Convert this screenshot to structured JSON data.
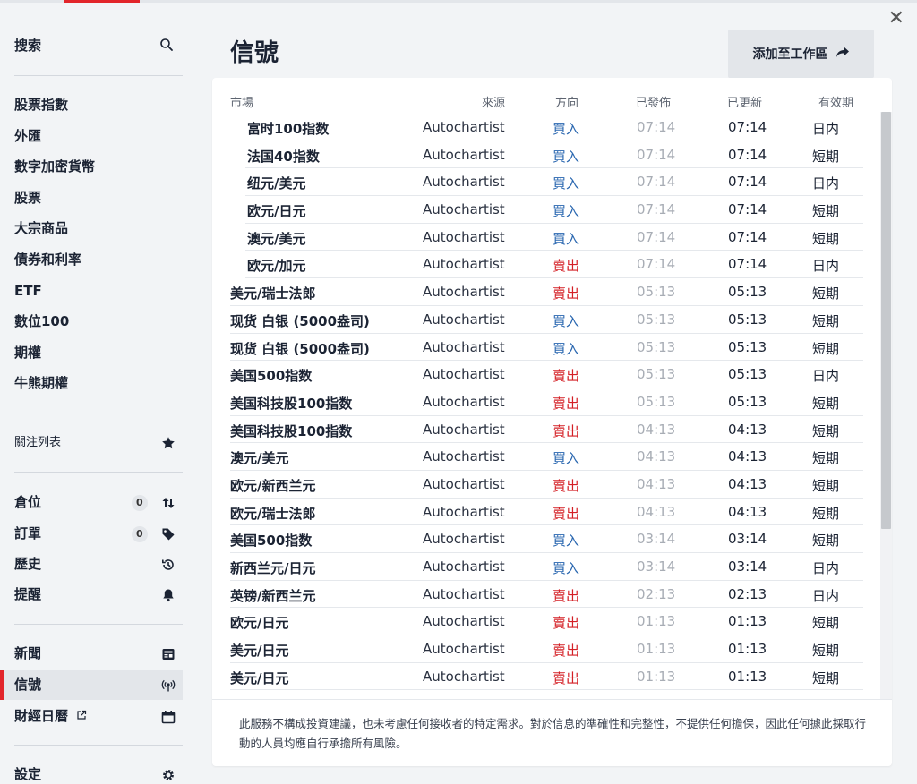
{
  "sidebar": {
    "search_label": "搜索",
    "markets": [
      "股票指數",
      "外匯",
      "數字加密貨幣",
      "股票",
      "大宗商品",
      "債券和利率",
      "ETF",
      "數位100",
      "期權",
      "牛熊期權"
    ],
    "watchlist_label": "關注列表",
    "positions_label": "倉位",
    "positions_count": "0",
    "orders_label": "訂單",
    "orders_count": "0",
    "history_label": "歷史",
    "alerts_label": "提醒",
    "news_label": "新聞",
    "signals_label": "信號",
    "calendar_label": "財經日曆",
    "settings_label": "設定"
  },
  "page": {
    "title": "信號",
    "add_button_label": "添加至工作區"
  },
  "table": {
    "headers": {
      "market": "市場",
      "source": "來源",
      "direction": "方向",
      "published": "已發佈",
      "updated": "已更新",
      "validity": "有效期"
    },
    "rows": [
      {
        "market": "富时100指数",
        "source": "Autochartist",
        "direction": "買入",
        "published": "07:14",
        "updated": "07:14",
        "validity": "日内",
        "indent": true
      },
      {
        "market": "法国40指数",
        "source": "Autochartist",
        "direction": "買入",
        "published": "07:14",
        "updated": "07:14",
        "validity": "短期",
        "indent": true
      },
      {
        "market": "纽元/美元",
        "source": "Autochartist",
        "direction": "買入",
        "published": "07:14",
        "updated": "07:14",
        "validity": "日内",
        "indent": true
      },
      {
        "market": "欧元/日元",
        "source": "Autochartist",
        "direction": "買入",
        "published": "07:14",
        "updated": "07:14",
        "validity": "短期",
        "indent": true
      },
      {
        "market": "澳元/美元",
        "source": "Autochartist",
        "direction": "買入",
        "published": "07:14",
        "updated": "07:14",
        "validity": "短期",
        "indent": true
      },
      {
        "market": "欧元/加元",
        "source": "Autochartist",
        "direction": "賣出",
        "published": "07:14",
        "updated": "07:14",
        "validity": "日内",
        "indent": true
      },
      {
        "market": "美元/瑞士法郎",
        "source": "Autochartist",
        "direction": "賣出",
        "published": "05:13",
        "updated": "05:13",
        "validity": "短期",
        "indent": false
      },
      {
        "market": "现货 白银 (5000盎司)",
        "source": "Autochartist",
        "direction": "買入",
        "published": "05:13",
        "updated": "05:13",
        "validity": "短期",
        "indent": false
      },
      {
        "market": "现货 白银 (5000盎司)",
        "source": "Autochartist",
        "direction": "買入",
        "published": "05:13",
        "updated": "05:13",
        "validity": "短期",
        "indent": false
      },
      {
        "market": "美国500指数",
        "source": "Autochartist",
        "direction": "賣出",
        "published": "05:13",
        "updated": "05:13",
        "validity": "日内",
        "indent": false
      },
      {
        "market": "美国科技股100指数",
        "source": "Autochartist",
        "direction": "賣出",
        "published": "05:13",
        "updated": "05:13",
        "validity": "短期",
        "indent": false
      },
      {
        "market": "美国科技股100指数",
        "source": "Autochartist",
        "direction": "賣出",
        "published": "04:13",
        "updated": "04:13",
        "validity": "短期",
        "indent": false
      },
      {
        "market": "澳元/美元",
        "source": "Autochartist",
        "direction": "買入",
        "published": "04:13",
        "updated": "04:13",
        "validity": "短期",
        "indent": false
      },
      {
        "market": "欧元/新西兰元",
        "source": "Autochartist",
        "direction": "賣出",
        "published": "04:13",
        "updated": "04:13",
        "validity": "短期",
        "indent": false
      },
      {
        "market": "欧元/瑞士法郎",
        "source": "Autochartist",
        "direction": "賣出",
        "published": "04:13",
        "updated": "04:13",
        "validity": "短期",
        "indent": false
      },
      {
        "market": "美国500指数",
        "source": "Autochartist",
        "direction": "買入",
        "published": "03:14",
        "updated": "03:14",
        "validity": "短期",
        "indent": false
      },
      {
        "market": "新西兰元/日元",
        "source": "Autochartist",
        "direction": "買入",
        "published": "03:14",
        "updated": "03:14",
        "validity": "日内",
        "indent": false
      },
      {
        "market": "英镑/新西兰元",
        "source": "Autochartist",
        "direction": "賣出",
        "published": "02:13",
        "updated": "02:13",
        "validity": "日内",
        "indent": false
      },
      {
        "market": "欧元/日元",
        "source": "Autochartist",
        "direction": "賣出",
        "published": "01:13",
        "updated": "01:13",
        "validity": "短期",
        "indent": false
      },
      {
        "market": "美元/日元",
        "source": "Autochartist",
        "direction": "賣出",
        "published": "01:13",
        "updated": "01:13",
        "validity": "短期",
        "indent": false
      },
      {
        "market": "美元/日元",
        "source": "Autochartist",
        "direction": "賣出",
        "published": "01:13",
        "updated": "01:13",
        "validity": "短期",
        "indent": false
      }
    ]
  },
  "disclaimer": "此服務不構成投資建議，也未考慮任何接收者的特定需求。對於信息的準確性和完整性，不提供任何擔保，因此任何據此採取行動的人員均應自行承擔所有風險。",
  "colors": {
    "accent": "#e2252b",
    "buy": "#2a67b0",
    "sell": "#d42026"
  }
}
